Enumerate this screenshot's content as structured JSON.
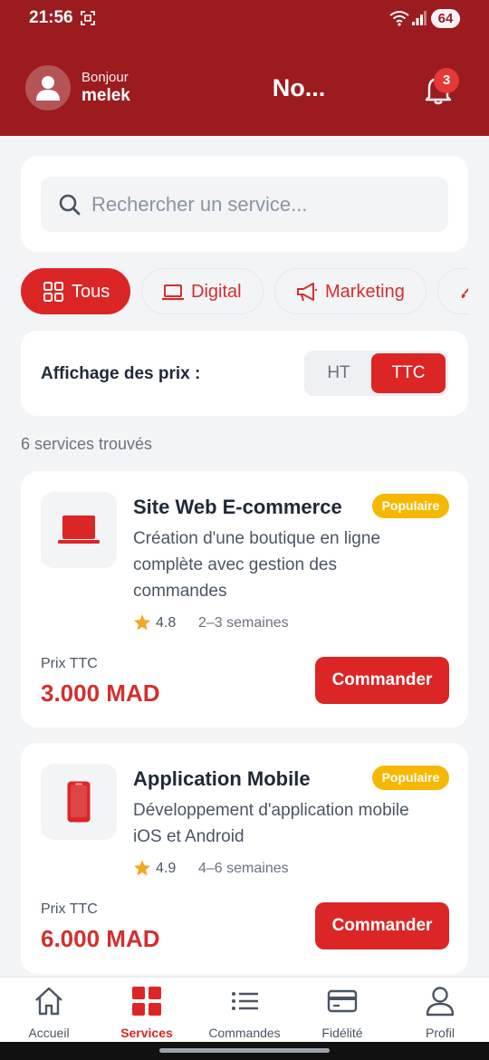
{
  "status_bar": {
    "time": "21:56",
    "battery": "64"
  },
  "header": {
    "greeting": "Bonjour",
    "username": "melek",
    "title": "No...",
    "notification_count": "3"
  },
  "search": {
    "placeholder": "Rechercher un service...",
    "value": ""
  },
  "filters": [
    {
      "label": "Tous",
      "icon": "grid-icon",
      "active": true
    },
    {
      "label": "Digital",
      "icon": "laptop-icon",
      "active": false
    },
    {
      "label": "Marketing",
      "icon": "megaphone-icon",
      "active": false
    },
    {
      "label": "",
      "icon": "brush-icon",
      "active": false
    }
  ],
  "price_display": {
    "label": "Affichage des prix :",
    "options": [
      "HT",
      "TTC"
    ],
    "selected": "TTC"
  },
  "results_count": "6 services trouvés",
  "services": [
    {
      "title": "Site Web E-commerce",
      "badge": "Populaire",
      "description": "Création d'une boutique en ligne complète avec gestion des commandes",
      "rating": "4.8",
      "duration": "2–3 semaines",
      "price_label": "Prix TTC",
      "price": "3.000 MAD",
      "button": "Commander",
      "icon": "laptop-icon"
    },
    {
      "title": "Application Mobile",
      "badge": "Populaire",
      "description": "Développement d'application mobile iOS et Android",
      "rating": "4.9",
      "duration": "4–6 semaines",
      "price_label": "Prix TTC",
      "price": "6.000 MAD",
      "button": "Commander",
      "icon": "smartphone-icon"
    }
  ],
  "bottom_nav": [
    {
      "label": "Accueil",
      "icon": "home-icon",
      "active": false
    },
    {
      "label": "Services",
      "icon": "services-grid-icon",
      "active": true
    },
    {
      "label": "Commandes",
      "icon": "list-icon",
      "active": false
    },
    {
      "label": "Fidélité",
      "icon": "card-icon",
      "active": false
    },
    {
      "label": "Profil",
      "icon": "user-icon",
      "active": false
    }
  ],
  "colors": {
    "header_bg": "#9b1b1f",
    "accent": "#dc2626",
    "badge": "#f5b800",
    "background": "#f3f4f6"
  }
}
